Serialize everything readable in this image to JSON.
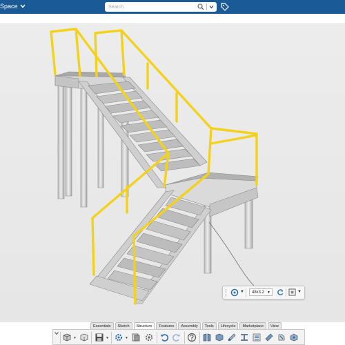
{
  "app": {
    "space_label": "Space",
    "search_placeholder": "Search"
  },
  "floating_toolbar": {
    "size_value": "48x3.2"
  },
  "ribbon": {
    "tabs": [
      {
        "label": "Essentials",
        "active": false
      },
      {
        "label": "Sketch",
        "active": false
      },
      {
        "label": "Structure",
        "active": true
      },
      {
        "label": "Features",
        "active": false
      },
      {
        "label": "Assembly",
        "active": false
      },
      {
        "label": "Tools",
        "active": false
      },
      {
        "label": "Lifecycle",
        "active": false
      },
      {
        "label": "Marketplace",
        "active": false
      },
      {
        "label": "View",
        "active": false
      }
    ]
  },
  "colors": {
    "header_bg": "#1a5a96",
    "railing": "#f2d21c",
    "steel": "#c8c8c8",
    "accent_blue": "#2d6db4"
  },
  "icons": [
    "chevron-down-icon",
    "search-icon",
    "tag-icon",
    "mate-icon",
    "flip-icon",
    "box-icon",
    "new-part-icon",
    "save-icon",
    "undo-icon",
    "redo-icon",
    "help-icon"
  ]
}
